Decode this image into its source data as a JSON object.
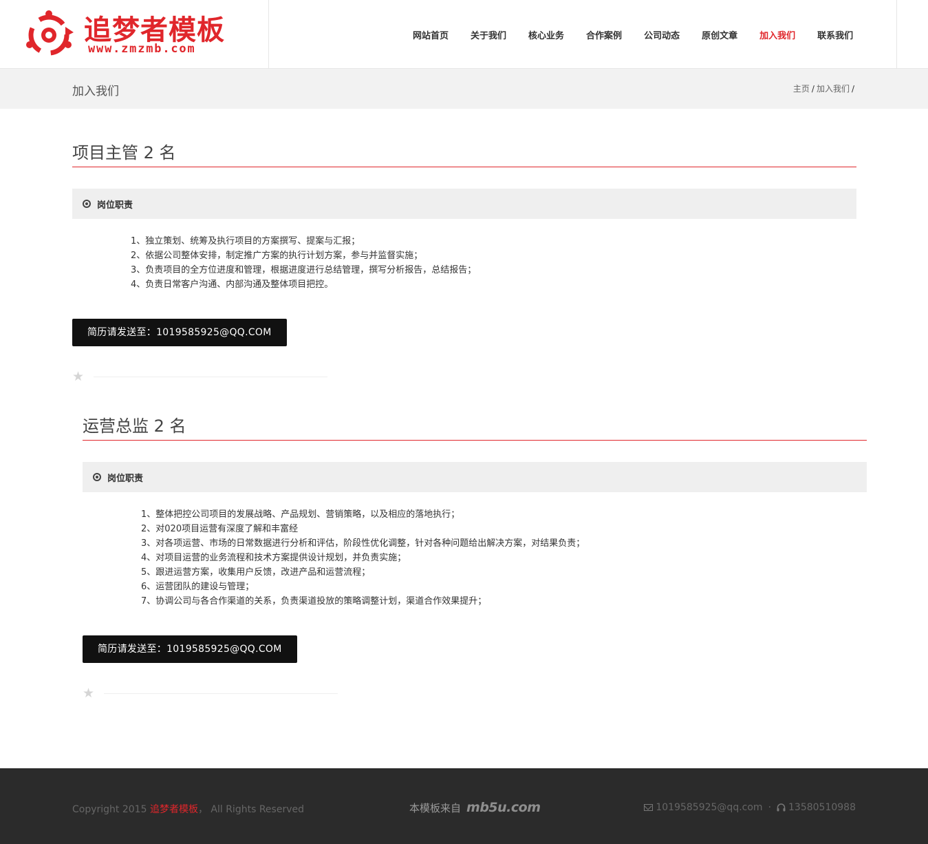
{
  "logo": {
    "title": "追梦者模板",
    "url": "www.zmzmb.com",
    "brand_color": "#e0262b"
  },
  "nav": {
    "items": [
      {
        "label": "网站首页"
      },
      {
        "label": "关于我们"
      },
      {
        "label": "核心业务"
      },
      {
        "label": "合作案例"
      },
      {
        "label": "公司动态"
      },
      {
        "label": "原创文章"
      },
      {
        "label": "加入我们",
        "active": true
      },
      {
        "label": "联系我们"
      }
    ]
  },
  "page": {
    "title": "加入我们",
    "breadcrumb": [
      {
        "label": "主页"
      },
      {
        "label": "加入我们"
      }
    ],
    "breadcrumb_sep": "/"
  },
  "jobs": [
    {
      "title": "项目主管 2 名",
      "duty_label": "岗位职责",
      "duties": [
        "1、独立策划、统筹及执行项目的方案撰写、提案与汇报；",
        "2、依据公司整体安排，制定推广方案的执行计划方案，参与并监督实施；",
        "3、负责项目的全方位进度和管理，根据进度进行总结管理，撰写分析报告，总结报告；",
        "4、负责日常客户沟通、内部沟通及整体项目把控。"
      ],
      "resume_button": "简历请发送至：1019585925@QQ.COM"
    },
    {
      "title": "运营总监 2 名",
      "duty_label": "岗位职责",
      "duties": [
        "1、整体把控公司项目的发展战略、产品规划、营销策略，以及相应的落地执行；",
        "2、对020项目运营有深度了解和丰富经",
        "3、对各项运营、市场的日常数据进行分析和评估，阶段性优化调整，针对各种问题给出解决方案，对结果负责；",
        "4、对项目运营的业务流程和技术方案提供设计规划，并负责实施；",
        "5、跟进运营方案，收集用户反馈，改进产品和运营流程；",
        "6、运营团队的建设与管理；",
        "7、协调公司与各合作渠道的关系，负责渠道投放的策略调整计划，渠道合作效果提升；"
      ],
      "resume_button": "简历请发送至：1019585925@QQ.COM"
    }
  ],
  "footer": {
    "copyright_prefix": "Copyright 2015",
    "copyright_brand": "追梦者模板",
    "copyright_suffix": "，  All Rights Reserved",
    "source_label": "本模板来自",
    "source_brand": "mb5u.com",
    "email": "1019585925@qq.com",
    "dot": "·",
    "phone": "13580510988",
    "background": "#2b2b2b"
  }
}
